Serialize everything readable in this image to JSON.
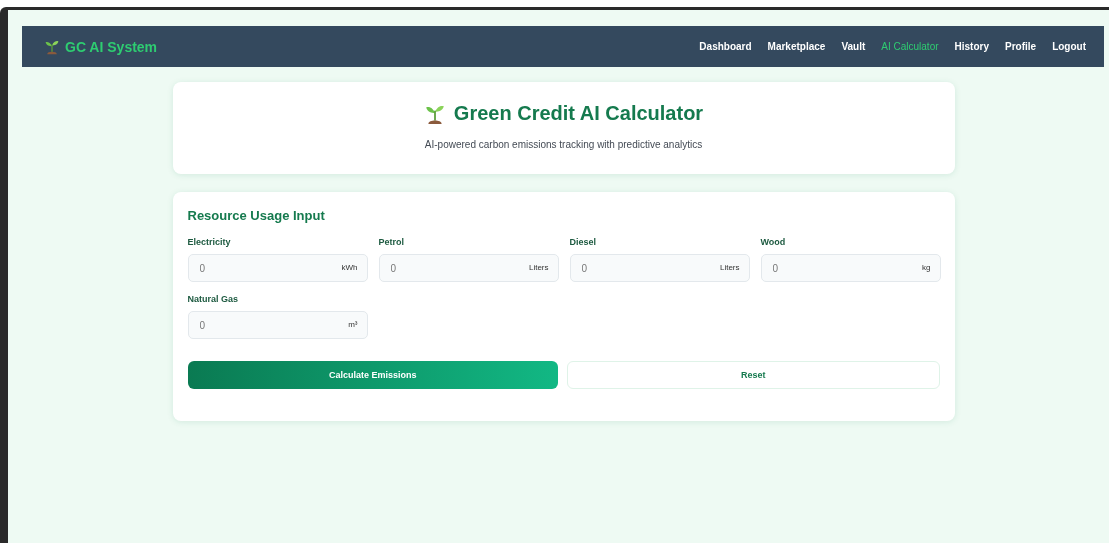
{
  "navbar": {
    "brand": "GC AI System",
    "links": [
      {
        "label": "Dashboard",
        "selected": false
      },
      {
        "label": "Marketplace",
        "selected": false
      },
      {
        "label": "Vault",
        "selected": false
      },
      {
        "label": "AI Calculator",
        "selected": true
      },
      {
        "label": "History",
        "selected": false
      },
      {
        "label": "Profile",
        "selected": false
      },
      {
        "label": "Logout",
        "selected": false
      }
    ]
  },
  "header": {
    "title": "Green Credit AI Calculator",
    "subtitle": "AI-powered carbon emissions tracking with predictive analytics"
  },
  "form": {
    "title": "Resource Usage Input",
    "fields": [
      {
        "label": "Electricity",
        "value": "0",
        "unit": "kWh"
      },
      {
        "label": "Petrol",
        "value": "0",
        "unit": "Liters"
      },
      {
        "label": "Diesel",
        "value": "0",
        "unit": "Liters"
      },
      {
        "label": "Wood",
        "value": "0",
        "unit": "kg"
      },
      {
        "label": "Natural Gas",
        "value": "0",
        "unit": "m³"
      }
    ],
    "buttons": [
      {
        "label": "Calculate Emissions",
        "kind": "primary"
      },
      {
        "label": "Reset",
        "kind": "secondary"
      }
    ]
  }
}
